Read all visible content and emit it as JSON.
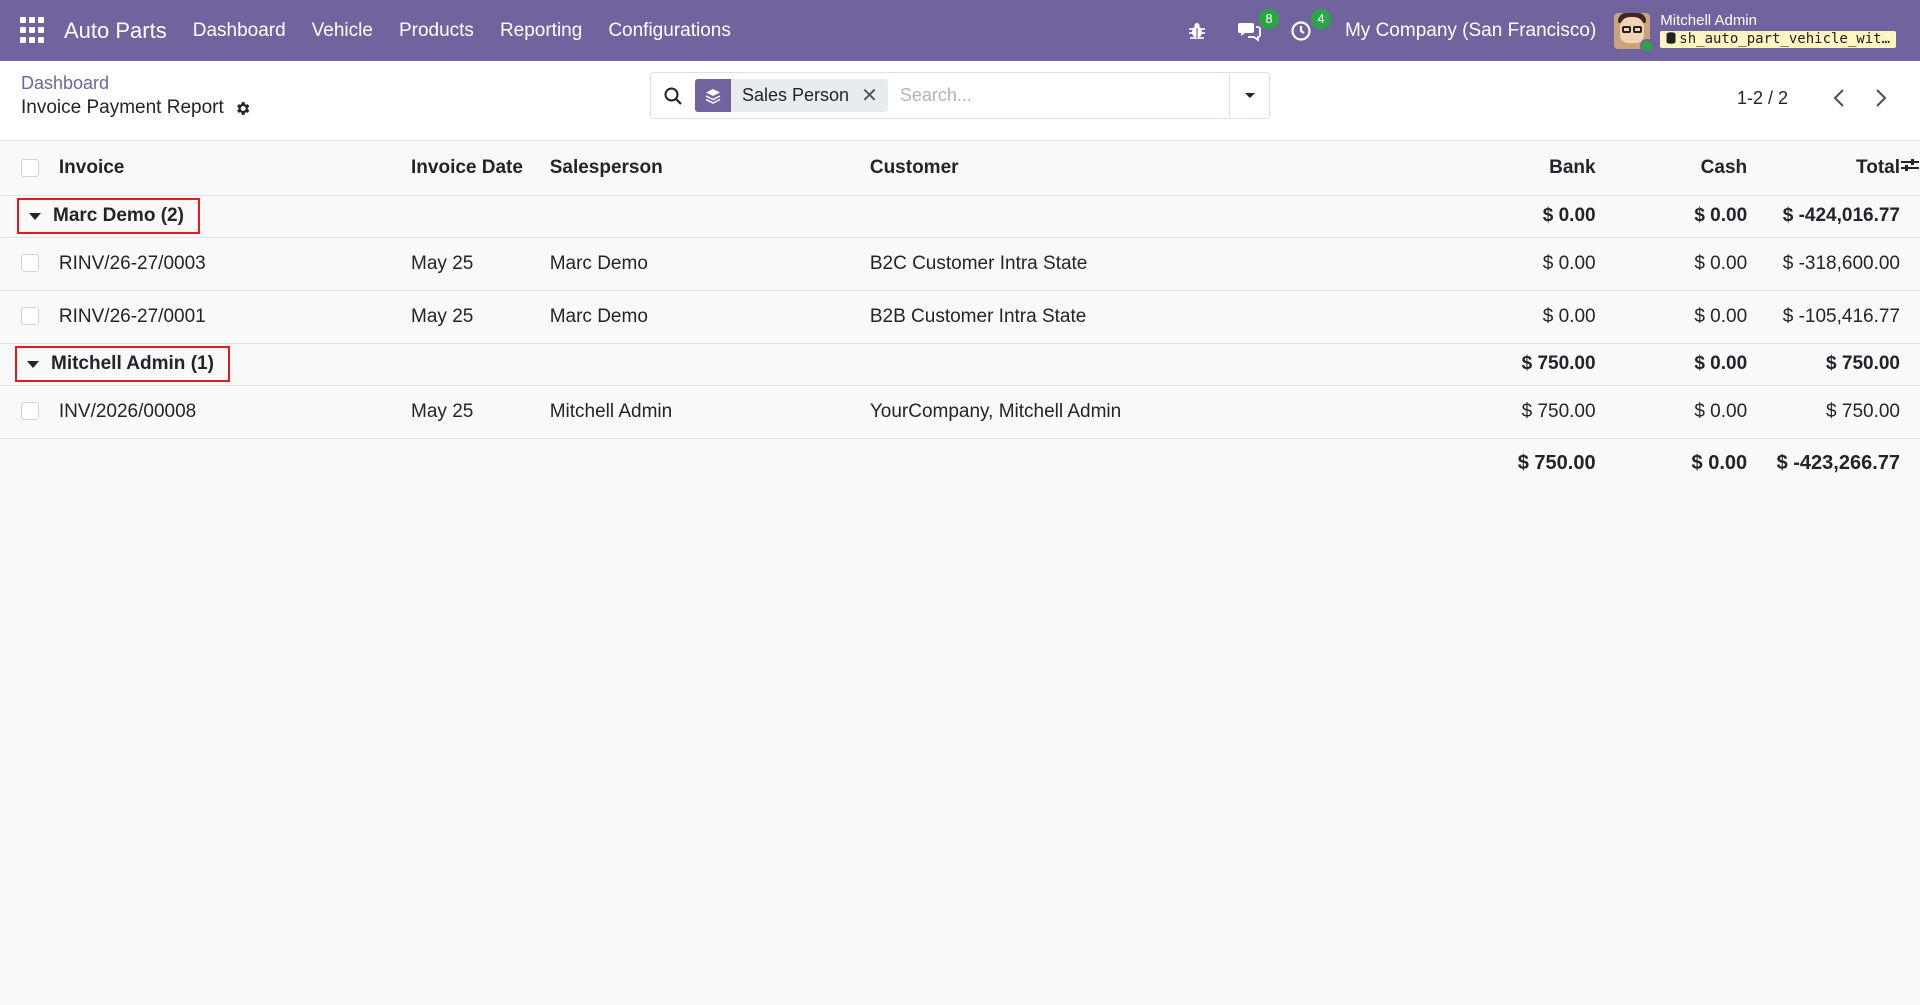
{
  "navbar": {
    "app_name": "Auto Parts",
    "menu": [
      "Dashboard",
      "Vehicle",
      "Products",
      "Reporting",
      "Configurations"
    ],
    "messages_count": "8",
    "activities_count": "4",
    "company": "My Company (San Francisco)",
    "user_name": "Mitchell Admin",
    "database": "sh_auto_part_vehicle_wit…"
  },
  "control_panel": {
    "breadcrumb": "Dashboard",
    "title": "Invoice Payment Report",
    "search": {
      "facet_label": "Sales Person",
      "placeholder": "Search..."
    },
    "pager": "1-2 / 2"
  },
  "table": {
    "headers": {
      "invoice": "Invoice",
      "date": "Invoice Date",
      "salesperson": "Salesperson",
      "customer": "Customer",
      "bank": "Bank",
      "cash": "Cash",
      "total": "Total"
    },
    "groups": [
      {
        "label": "Marc Demo (2)",
        "bank": "$ 0.00",
        "cash": "$ 0.00",
        "total": "$ -424,016.77",
        "rows": [
          {
            "invoice": "RINV/26-27/0003",
            "date": "May 25",
            "salesperson": "Marc Demo",
            "customer": "B2C Customer Intra State",
            "bank": "$ 0.00",
            "cash": "$ 0.00",
            "total": "$ -318,600.00"
          },
          {
            "invoice": "RINV/26-27/0001",
            "date": "May 25",
            "salesperson": "Marc Demo",
            "customer": "B2B Customer Intra State",
            "bank": "$ 0.00",
            "cash": "$ 0.00",
            "total": "$ -105,416.77"
          }
        ]
      },
      {
        "label": "Mitchell Admin (1)",
        "bank": "$ 750.00",
        "cash": "$ 0.00",
        "total": "$ 750.00",
        "rows": [
          {
            "invoice": "INV/2026/00008",
            "date": "May 25",
            "salesperson": "Mitchell Admin",
            "customer": "YourCompany, Mitchell Admin",
            "bank": "$ 750.00",
            "cash": "$ 0.00",
            "total": "$ 750.00"
          }
        ]
      }
    ],
    "totals": {
      "bank": "$ 750.00",
      "cash": "$ 0.00",
      "total": "$ -423,266.77"
    }
  },
  "colors": {
    "navbar": "#71639e",
    "badge": "#28a745",
    "highlight": "#e01b1b"
  }
}
